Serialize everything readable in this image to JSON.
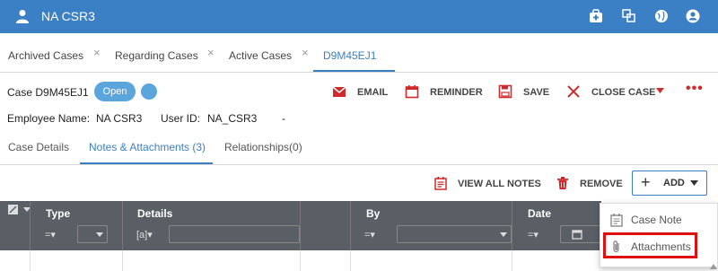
{
  "header": {
    "title": "NA CSR3",
    "icons": [
      "user-icon",
      "medkit-icon",
      "copy-icon",
      "globe-icon",
      "account-icon"
    ]
  },
  "tabs": [
    {
      "label": "Archived Cases",
      "close": "×"
    },
    {
      "label": "Regarding Cases",
      "close": "×"
    },
    {
      "label": "Active Cases",
      "close": "×"
    },
    {
      "label": "D9M45EJ1",
      "active": true
    }
  ],
  "case": {
    "label": "Case D9M45EJ1",
    "status": "Open",
    "actions": {
      "email": "EMAIL",
      "reminder": "REMINDER",
      "save": "SAVE",
      "close_case": "CLOSE CASE"
    },
    "more": "•••",
    "employee_label": "Employee Name:",
    "employee_value": "NA CSR3",
    "userid_label": "User ID:",
    "userid_value": "NA_CSR3",
    "dash": "-"
  },
  "subtabs": [
    {
      "label": "Case Details"
    },
    {
      "label": "Notes & Attachments (3)",
      "active": true
    },
    {
      "label": "Relationships(0)"
    }
  ],
  "toolbar": {
    "view_all": "VIEW ALL NOTES",
    "remove": "REMOVE",
    "add": "ADD"
  },
  "grid": {
    "columns": [
      "Type",
      "Details",
      "By",
      "Date"
    ],
    "filter_op": "=▾",
    "details_filter_op": "[a]▾"
  },
  "add_menu": {
    "items": [
      {
        "label": "Case Note",
        "icon": "calendar-note-icon"
      },
      {
        "label": "Attachments",
        "icon": "paperclip-icon"
      }
    ]
  },
  "colors": {
    "primary": "#3b7fc4",
    "accent": "#d12a2a",
    "grid_header": "#5a5f66"
  }
}
